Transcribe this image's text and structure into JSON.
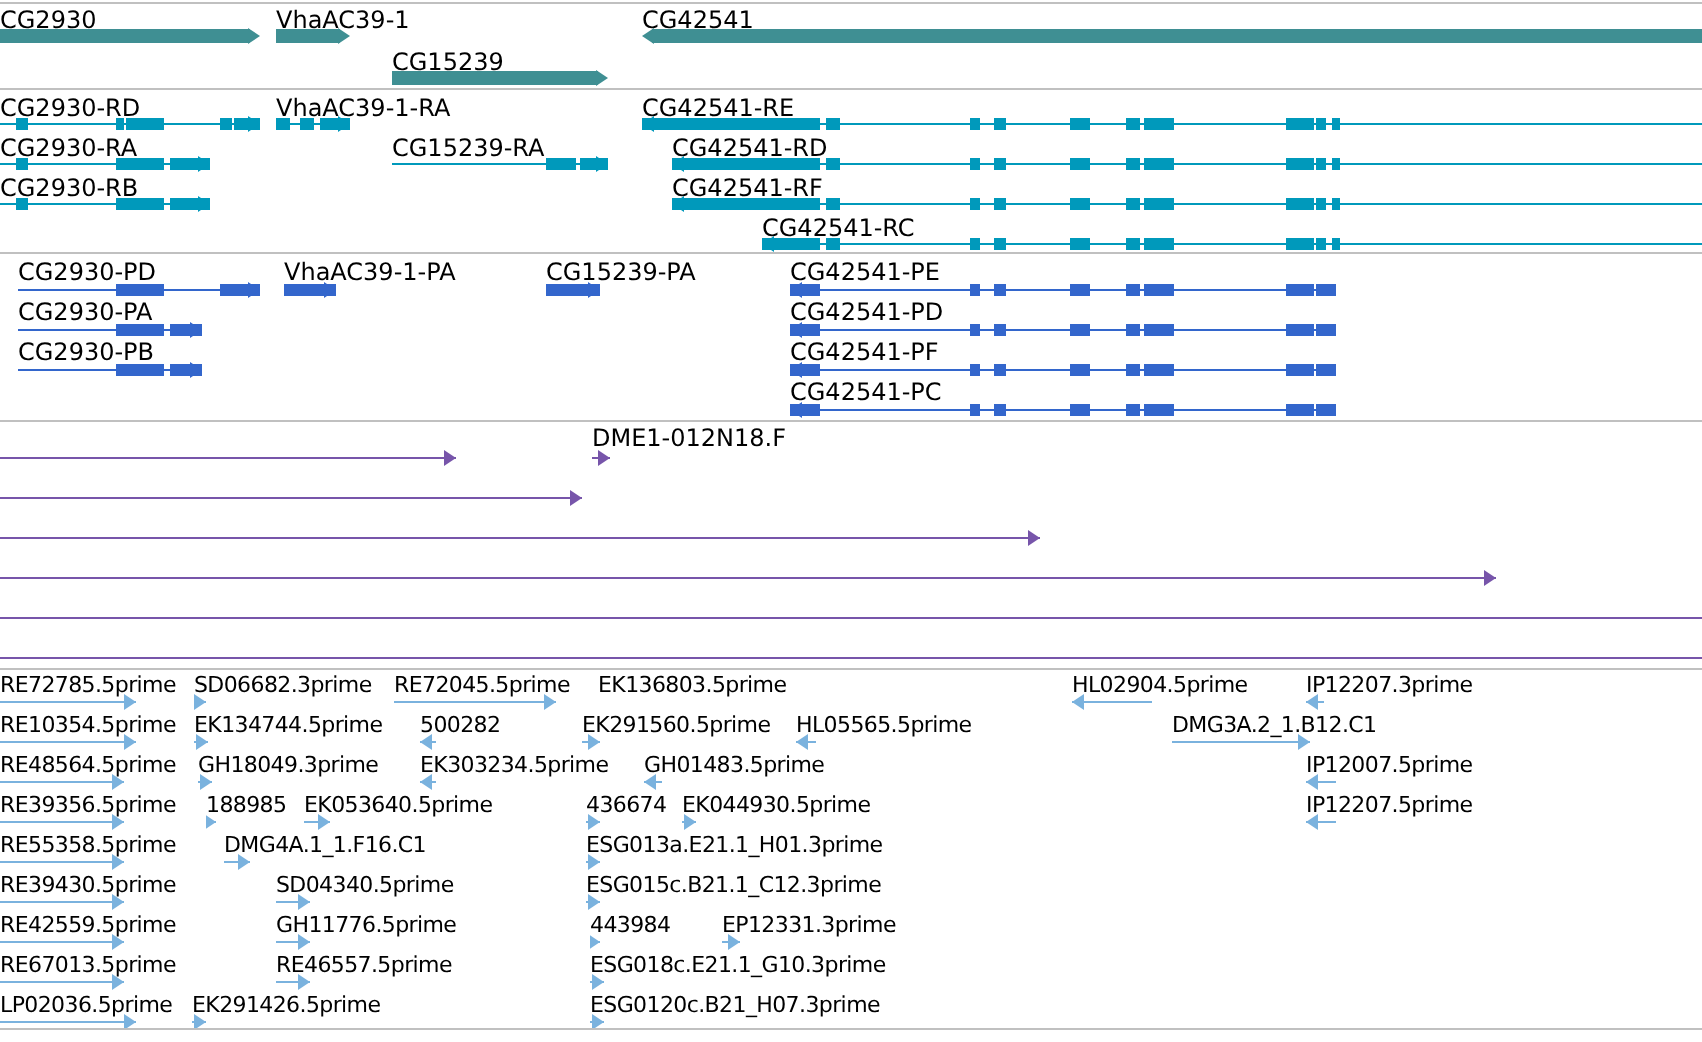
{
  "tracks": [
    {
      "kind": "genes",
      "features": [
        {
          "label": "CG2930",
          "reverse": false
        },
        {
          "label": "VhaAC39-1",
          "reverse": false
        },
        {
          "label": "CG42541",
          "reverse": true
        },
        {
          "label": "CG15239",
          "reverse": false
        }
      ]
    },
    {
      "kind": "transcripts",
      "features": [
        {
          "label": "CG2930-RD",
          "reverse": false
        },
        {
          "label": "VhaAC39-1-RA",
          "reverse": false
        },
        {
          "label": "CG42541-RE",
          "reverse": true
        },
        {
          "label": "CG2930-RA",
          "reverse": false
        },
        {
          "label": "CG15239-RA",
          "reverse": false
        },
        {
          "label": "CG42541-RD",
          "reverse": true
        },
        {
          "label": "CG2930-RB",
          "reverse": false
        },
        {
          "label": "CG42541-RF",
          "reverse": true
        },
        {
          "label": "CG42541-RC",
          "reverse": true
        }
      ]
    },
    {
      "kind": "proteins",
      "features": [
        {
          "label": "CG2930-PD",
          "reverse": false
        },
        {
          "label": "VhaAC39-1-PA",
          "reverse": false
        },
        {
          "label": "CG15239-PA",
          "reverse": false
        },
        {
          "label": "CG42541-PE",
          "reverse": true
        },
        {
          "label": "CG2930-PA",
          "reverse": false
        },
        {
          "label": "CG42541-PD",
          "reverse": true
        },
        {
          "label": "CG2930-PB",
          "reverse": false
        },
        {
          "label": "CG42541-PF",
          "reverse": true
        },
        {
          "label": "CG42541-PC",
          "reverse": true
        }
      ]
    },
    {
      "kind": "clones",
      "features": [
        {
          "reverse": false
        },
        {
          "label": "DME1-012N18.F",
          "reverse": false
        },
        {
          "reverse": false
        },
        {
          "reverse": false
        },
        {
          "reverse": false
        },
        {
          "kind": "line"
        },
        {
          "kind": "line"
        }
      ]
    },
    {
      "kind": "ests",
      "features": [
        {
          "label": "RE72785.5prime",
          "reverse": false
        },
        {
          "label": "SD06682.3prime",
          "reverse": false
        },
        {
          "label": "RE72045.5prime",
          "reverse": false
        },
        {
          "label": "EK136803.5prime"
        },
        {
          "label": "HL02904.5prime",
          "reverse": true
        },
        {
          "label": "IP12207.3prime",
          "reverse": true
        },
        {
          "label": "RE10354.5prime",
          "reverse": false
        },
        {
          "label": "EK134744.5prime",
          "reverse": false
        },
        {
          "label": "500282",
          "reverse": true
        },
        {
          "label": "EK291560.5prime",
          "reverse": false
        },
        {
          "label": "HL05565.5prime",
          "reverse": true
        },
        {
          "label": "DMG3A.2_1.B12.C1",
          "reverse": false
        },
        {
          "label": "RE48564.5prime",
          "reverse": false
        },
        {
          "label": "GH18049.3prime",
          "reverse": false
        },
        {
          "label": "EK303234.5prime",
          "reverse": true
        },
        {
          "label": "GH01483.5prime",
          "reverse": true
        },
        {
          "label": "IP12007.5prime",
          "reverse": true
        },
        {
          "label": "RE39356.5prime",
          "reverse": false
        },
        {
          "label": "188985",
          "reverse": false
        },
        {
          "label": "EK053640.5prime",
          "reverse": false
        },
        {
          "label": "436674",
          "reverse": false
        },
        {
          "label": "EK044930.5prime",
          "reverse": false
        },
        {
          "label": "IP12207.5prime",
          "reverse": true
        },
        {
          "label": "RE55358.5prime",
          "reverse": false
        },
        {
          "label": "DMG4A.1_1.F16.C1",
          "reverse": false
        },
        {
          "label": "ESG013a.E21.1_H01.3prime",
          "reverse": false
        },
        {
          "label": "RE39430.5prime",
          "reverse": false
        },
        {
          "label": "SD04340.5prime",
          "reverse": false
        },
        {
          "label": "ESG015c.B21.1_C12.3prime",
          "reverse": false
        },
        {
          "label": "RE42559.5prime",
          "reverse": false
        },
        {
          "label": "GH11776.5prime",
          "reverse": false
        },
        {
          "label": "443984",
          "reverse": false
        },
        {
          "label": "EP12331.3prime",
          "reverse": false
        },
        {
          "label": "RE67013.5prime",
          "reverse": false
        },
        {
          "label": "RE46557.5prime",
          "reverse": false
        },
        {
          "label": "ESG018c.E21.1_G10.3prime",
          "reverse": false
        },
        {
          "label": "LP02036.5prime",
          "reverse": false
        },
        {
          "label": "EK291426.5prime",
          "reverse": false
        },
        {
          "label": "ESG0120c.B21_H07.3prime",
          "reverse": false
        }
      ]
    }
  ]
}
